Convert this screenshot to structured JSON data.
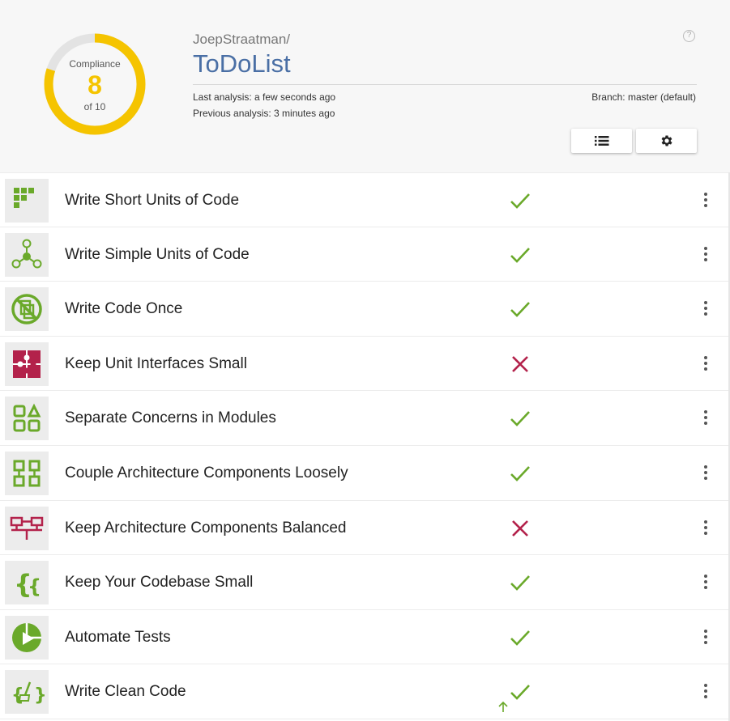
{
  "header": {
    "owner": "JoepStraatman/",
    "repo": "ToDoList",
    "last_analysis": "Last analysis: a few seconds ago",
    "previous_analysis": "Previous analysis: 3 minutes ago",
    "branch": "Branch: master (default)",
    "help_icon": "question-circle-icon",
    "list_button_icon": "list-icon",
    "settings_button_icon": "gear-icon"
  },
  "compliance": {
    "label": "Compliance",
    "value": "8",
    "of": "of 10",
    "fraction": 0.8,
    "color": "#f5c400",
    "track_color": "#e3e3e3"
  },
  "colors": {
    "pass": "#6aa92a",
    "fail": "#b3224b",
    "repo_title": "#4a6fa5"
  },
  "guidelines": [
    {
      "name": "Write Short Units of Code",
      "status": "pass",
      "icon": "short-units-icon"
    },
    {
      "name": "Write Simple Units of Code",
      "status": "pass",
      "icon": "simple-units-icon"
    },
    {
      "name": "Write Code Once",
      "status": "pass",
      "icon": "code-once-icon"
    },
    {
      "name": "Keep Unit Interfaces Small",
      "status": "fail",
      "icon": "puzzle-icon"
    },
    {
      "name": "Separate Concerns in Modules",
      "status": "pass",
      "icon": "modules-icon"
    },
    {
      "name": "Couple Architecture Components Loosely",
      "status": "pass",
      "icon": "components-icon"
    },
    {
      "name": "Keep Architecture Components Balanced",
      "status": "fail",
      "icon": "balance-icon"
    },
    {
      "name": "Keep Your Codebase Small",
      "status": "pass",
      "icon": "braces-icon"
    },
    {
      "name": "Automate Tests",
      "status": "pass",
      "icon": "play-test-icon"
    },
    {
      "name": "Write Clean Code",
      "status": "pass",
      "icon": "clean-code-icon"
    }
  ]
}
